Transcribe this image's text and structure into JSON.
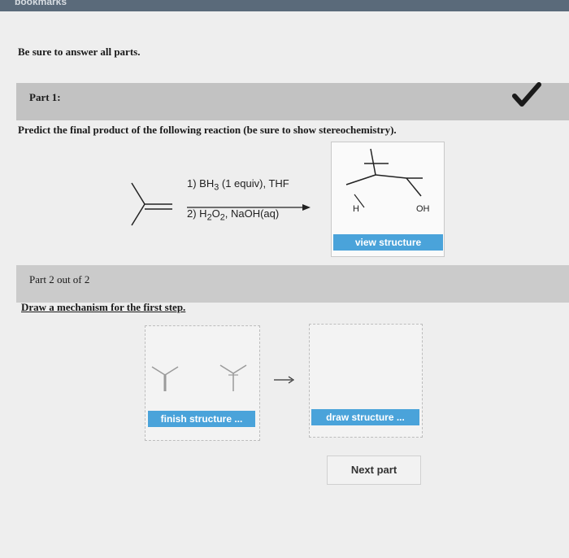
{
  "browser": {
    "bookmarks_label": "bookmarks"
  },
  "instructions": "Be sure to answer all parts.",
  "part1": {
    "title": "Part 1:",
    "question": "Predict the final product of the following reaction (be sure to show stereochemistry).",
    "reaction": {
      "condition_1_pre": "1) BH",
      "condition_1_sub": "3",
      "condition_1_post": " (1 equiv), THF",
      "condition_2_pre": "2) H",
      "condition_2_sub1": "2",
      "condition_2_mid": "O",
      "condition_2_sub2": "2",
      "condition_2_post": ", NaOH(aq)"
    },
    "product": {
      "label_h": "H",
      "label_oh": "OH"
    },
    "view_structure_label": "view structure",
    "status": "correct"
  },
  "part2": {
    "title": "Part 2 out of 2",
    "question": "Draw a mechanism for the first step.",
    "finish_label": "finish structure ...",
    "draw_label": "draw structure ...",
    "next_label": "Next part"
  }
}
